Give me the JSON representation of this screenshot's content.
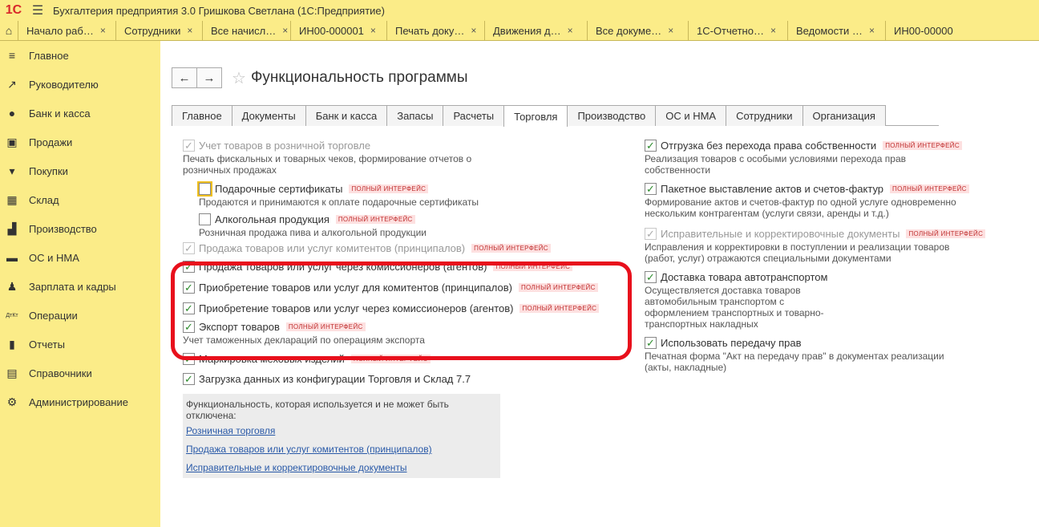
{
  "window": {
    "app_title": "Бухгалтерия предприятия 3.0 Гришкова Светлана  (1С:Предприятие)",
    "logo_text": "1С"
  },
  "tabs": [
    {
      "label": "Начало раб…"
    },
    {
      "label": "Сотрудники"
    },
    {
      "label": "Все начисл…"
    },
    {
      "label": "ИН00-000001"
    },
    {
      "label": "Печать доку…"
    },
    {
      "label": "Движения д…"
    },
    {
      "label": "Все докуме…"
    },
    {
      "label": "1С-Отчетно…"
    },
    {
      "label": "Ведомости …"
    },
    {
      "label": "ИН00-00000"
    }
  ],
  "tab_close": "×",
  "sidebar": {
    "items": [
      {
        "label": "Главное",
        "icon": "menu-icon",
        "glyph": "≡"
      },
      {
        "label": "Руководителю",
        "icon": "trend-icon",
        "glyph": "↗"
      },
      {
        "label": "Банк и касса",
        "icon": "bank-icon",
        "glyph": "●"
      },
      {
        "label": "Продажи",
        "icon": "bag-icon",
        "glyph": "▣"
      },
      {
        "label": "Покупки",
        "icon": "cart-icon",
        "glyph": "▾"
      },
      {
        "label": "Склад",
        "icon": "warehouse-icon",
        "glyph": "▦"
      },
      {
        "label": "Производство",
        "icon": "factory-icon",
        "glyph": "▟"
      },
      {
        "label": "ОС и НМА",
        "icon": "truck-icon",
        "glyph": "▬"
      },
      {
        "label": "Зарплата и кадры",
        "icon": "person-icon",
        "glyph": "♟"
      },
      {
        "label": "Операции",
        "icon": "operations-icon",
        "glyph": "ДтКт"
      },
      {
        "label": "Отчеты",
        "icon": "reports-icon",
        "glyph": "▮"
      },
      {
        "label": "Справочники",
        "icon": "book-icon",
        "glyph": "▤"
      },
      {
        "label": "Администрирование",
        "icon": "gear-icon",
        "glyph": "⚙"
      }
    ]
  },
  "page": {
    "title": "Функциональность программы",
    "back": "←",
    "forward": "→",
    "star": "☆"
  },
  "form_tabs": [
    {
      "label": "Главное"
    },
    {
      "label": "Документы"
    },
    {
      "label": "Банк и касса"
    },
    {
      "label": "Запасы"
    },
    {
      "label": "Расчеты"
    },
    {
      "label": "Торговля",
      "active": true
    },
    {
      "label": "Производство"
    },
    {
      "label": "ОС и НМА"
    },
    {
      "label": "Сотрудники"
    },
    {
      "label": "Организация"
    }
  ],
  "badge": "ПОЛНЫЙ ИНТЕРФЕЙС",
  "check_mark": "✓",
  "left": {
    "retail": {
      "label": "Учет товаров в розничной торговле",
      "checked": true,
      "disabled": true
    },
    "retail_desc": "Печать фискальных и товарных чеков, формирование отчетов о розничных продажах",
    "gift": {
      "label": "Подарочные сертификаты",
      "checked": false
    },
    "gift_desc": "Продаются и принимаются к оплате подарочные сертификаты",
    "alco": {
      "label": "Алкогольная продукция",
      "checked": false
    },
    "alco_desc": "Розничная продажа пива и алкогольной продукции",
    "consign_sale": {
      "label": "Продажа товаров или услуг комитентов (принципалов)",
      "checked": true,
      "disabled": true
    },
    "agent_sale": {
      "label": "Продажа товаров или услуг через комиссионеров (агентов)",
      "checked": true
    },
    "consign_buy": {
      "label": "Приобретение товаров или услуг для комитентов (принципалов)",
      "checked": true
    },
    "agent_buy": {
      "label": "Приобретение товаров или услуг через комиссионеров (агентов)",
      "checked": true
    },
    "export": {
      "label": "Экспорт товаров",
      "checked": true
    },
    "export_desc": "Учет таможенных деклараций по операциям экспорта",
    "fur": {
      "label": "Маркировка меховых изделий",
      "checked": true
    },
    "load": {
      "label": "Загрузка данных из конфигурации Торговля и Склад 7.7",
      "checked": true
    },
    "locked_title": "Функциональность, которая используется и не может быть отключена:",
    "locked_links": [
      "Розничная торговля",
      "Продажа товаров или услуг комитентов (принципалов)",
      "Исправительные и корректировочные документы"
    ]
  },
  "right": {
    "shipment": {
      "label": "Отгрузка без перехода права собственности",
      "checked": true
    },
    "shipment_desc": "Реализация товаров с особыми условиями перехода прав собственности",
    "batch": {
      "label": "Пакетное выставление актов и счетов-фактур",
      "checked": true
    },
    "batch_desc": "Формирование актов и счетов-фактур по одной услуге одновременно нескольким контрагентам (услуги связи, аренды и т.д.)",
    "correct": {
      "label": "Исправительные и корректировочные документы",
      "checked": true,
      "disabled": true
    },
    "correct_desc": "Исправления и корректировки в поступлении и реализации товаров (работ, услуг) отражаются специальными документами",
    "delivery": {
      "label": "Доставка товара автотранспортом",
      "checked": true
    },
    "delivery_desc": "Осуществляется доставка товаров автомобильным транспортом с оформлением транспортных и товарно-транспортных накладных",
    "rights": {
      "label": "Использовать передачу прав",
      "checked": true
    },
    "rights_desc": "Печатная форма \"Акт на передачу прав\" в документах реализации (акты, накладные)"
  }
}
